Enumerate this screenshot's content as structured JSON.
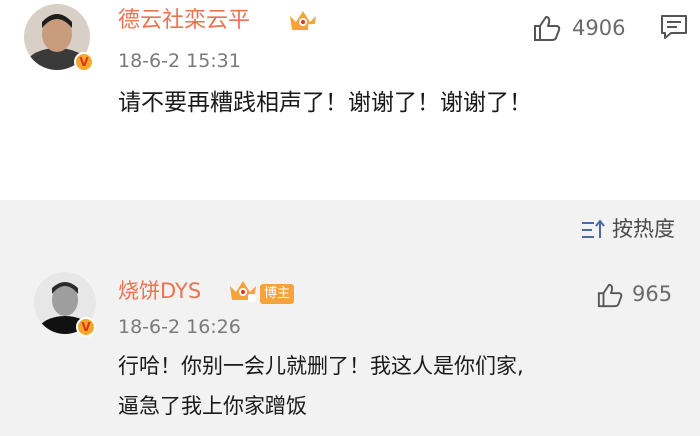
{
  "main_comment": {
    "author": "德云社栾云平",
    "time": "18-6-2 15:31",
    "text": "请不要再糟践相声了！谢谢了！谢谢了！",
    "likes": "4906",
    "badge": "V"
  },
  "sort": {
    "label": "按热度"
  },
  "reply": {
    "author": "烧饼DYS",
    "tag": "博主",
    "time": "18-6-2 16:26",
    "text_line1": "行哈！你别一会儿就删了！我这人是你们家,",
    "text_line2": "逼急了我上你家蹭饭",
    "likes": "965",
    "badge": "V"
  },
  "colors": {
    "name": "#eb7350",
    "crown": "#f6a339",
    "badge": "#f7a82c"
  }
}
